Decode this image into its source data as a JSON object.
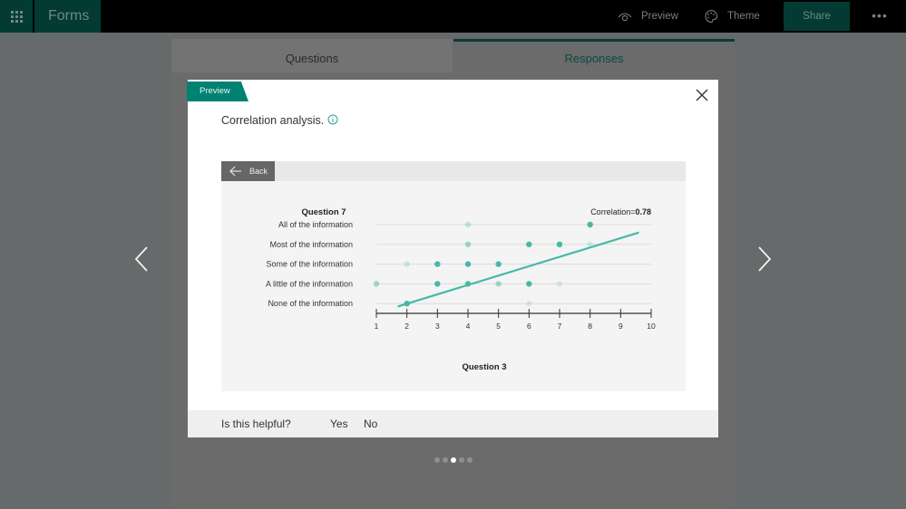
{
  "topbar": {
    "app_name": "Forms",
    "preview_label": "Preview",
    "theme_label": "Theme",
    "share_label": "Share",
    "more_label": "•••"
  },
  "tabs": [
    {
      "label": "Questions",
      "active": false
    },
    {
      "label": "Responses",
      "active": true
    }
  ],
  "modal": {
    "tag": "Preview",
    "title": "Correlation analysis.",
    "back_label": "Back",
    "feedback": {
      "question": "Is this helpful?",
      "yes": "Yes",
      "no": "No"
    }
  },
  "pager": {
    "count": 5,
    "active_index": 2
  },
  "colors": {
    "accent": "#008272",
    "point_dark": "#47b8a8",
    "line": "#47b8a8",
    "topbar_brand": "#033b34"
  },
  "chart_data": {
    "type": "scatter",
    "title": "Question 7",
    "annotation_prefix": "Correlation=",
    "annotation_value": "0.78",
    "xlabel": "Question 3",
    "ylabel": "Question 7",
    "xlim": [
      1,
      10
    ],
    "x_ticks": [
      "1",
      "2",
      "3",
      "4",
      "5",
      "6",
      "7",
      "8",
      "9",
      "10"
    ],
    "categories": [
      "All of the information",
      "Most of the information",
      "Some of the information",
      "A little of the information",
      "None of the information"
    ],
    "points": [
      {
        "category": "All of the information",
        "x": 4,
        "weight": 0.3
      },
      {
        "category": "All of the information",
        "x": 8,
        "weight": 1.0
      },
      {
        "category": "Most of the information",
        "x": 4,
        "weight": 0.5
      },
      {
        "category": "Most of the information",
        "x": 6,
        "weight": 1.0
      },
      {
        "category": "Most of the information",
        "x": 7,
        "weight": 1.0
      },
      {
        "category": "Most of the information",
        "x": 8,
        "weight": 0.2
      },
      {
        "category": "Some of the information",
        "x": 2,
        "weight": 0.25
      },
      {
        "category": "Some of the information",
        "x": 3,
        "weight": 1.0
      },
      {
        "category": "Some of the information",
        "x": 4,
        "weight": 1.0
      },
      {
        "category": "Some of the information",
        "x": 5,
        "weight": 1.0
      },
      {
        "category": "A little of the information",
        "x": 1,
        "weight": 0.5
      },
      {
        "category": "A little of the information",
        "x": 3,
        "weight": 1.0
      },
      {
        "category": "A little of the information",
        "x": 4,
        "weight": 1.0
      },
      {
        "category": "A little of the information",
        "x": 5,
        "weight": 0.5
      },
      {
        "category": "A little of the information",
        "x": 6,
        "weight": 1.0
      },
      {
        "category": "A little of the information",
        "x": 7,
        "weight": 0.2
      },
      {
        "category": "None of the information",
        "x": 2,
        "weight": 1.0
      },
      {
        "category": "None of the information",
        "x": 6,
        "weight": 0.2
      }
    ],
    "trend_line": {
      "x_start": 1.7,
      "y_start": -0.15,
      "x_end": 9.6,
      "y_end": 3.6
    },
    "grid": true
  }
}
